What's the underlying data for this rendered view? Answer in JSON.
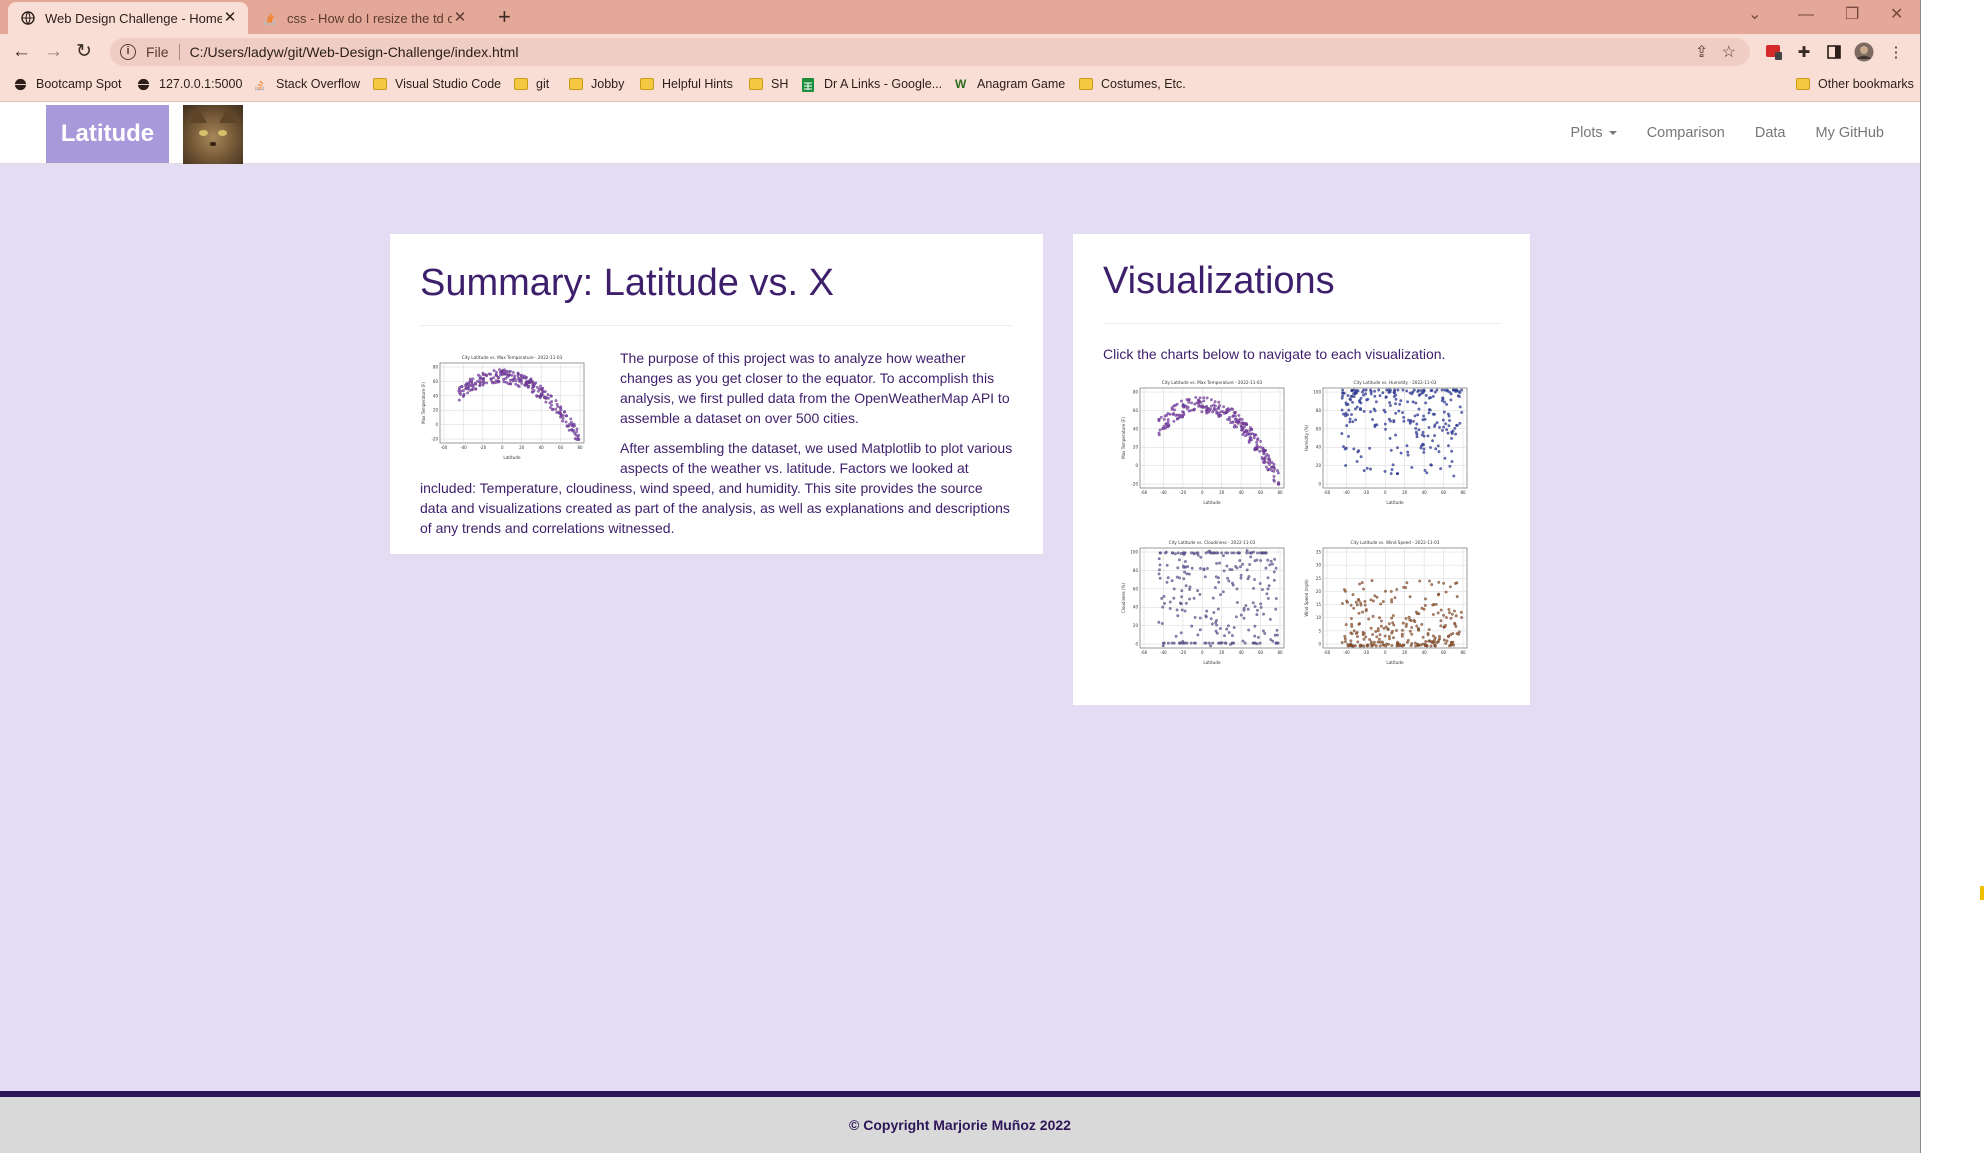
{
  "browser": {
    "tabs": [
      {
        "title": "Web Design Challenge - Home",
        "active": true,
        "icon": "globe-icon"
      },
      {
        "title": "css - How do I resize the td of a t",
        "active": false,
        "icon": "stackoverflow-icon"
      }
    ],
    "address": {
      "scheme": "File",
      "url": "C:/Users/ladyw/git/Web-Design-Challenge/index.html"
    },
    "bookmarks": [
      {
        "label": "Bootcamp Spot",
        "icon": "globe-icon"
      },
      {
        "label": "127.0.0.1:5000",
        "icon": "globe-icon"
      },
      {
        "label": "Stack Overflow",
        "icon": "stackoverflow-icon"
      },
      {
        "label": "Visual Studio Code",
        "icon": "folder-icon"
      },
      {
        "label": "git",
        "icon": "folder-icon"
      },
      {
        "label": "Jobby",
        "icon": "folder-icon"
      },
      {
        "label": "Helpful Hints",
        "icon": "folder-icon"
      },
      {
        "label": "SH",
        "icon": "folder-icon"
      },
      {
        "label": "Dr A Links - Google...",
        "icon": "sheets-icon"
      },
      {
        "label": "Anagram Game",
        "icon": "w-icon"
      },
      {
        "label": "Costumes, Etc.",
        "icon": "folder-icon"
      }
    ],
    "other_bookmarks": "Other bookmarks"
  },
  "navbar": {
    "brand": "Latitude",
    "links": {
      "plots": "Plots",
      "comparison": "Comparison",
      "data": "Data",
      "github": "My GitHub"
    }
  },
  "summary": {
    "title": "Summary: Latitude vs. X",
    "paragraph1": "The purpose of this project was to analyze how weather changes as you get closer to the equator. To accomplish this analysis, we first pulled data from the OpenWeatherMap API to assemble a dataset on over 500 cities.",
    "paragraph2": "After assembling the dataset, we used Matplotlib to plot various aspects of the weather vs. latitude. Factors we looked at included: Temperature, cloudiness, wind speed, and humidity. This site provides the source data and visualizations created as part of the analysis, as well as explanations and descriptions of any trends and correlations witnessed.",
    "thumbnail_title": "City Latitude vs. Max Temperature - 2022-11-03"
  },
  "visualizations": {
    "title": "Visualizations",
    "intro": "Click the charts below to navigate to each visualization.",
    "charts": [
      {
        "key": "temp",
        "title": "City Latitude vs. Max Temperature - 2022-11-03",
        "ylabel": "Max Temperature (F)",
        "xlabel": "Latitude",
        "color": "#8a3fc2",
        "shape": "arch",
        "yticks": [
          "-20",
          "0",
          "20",
          "40",
          "60",
          "80"
        ]
      },
      {
        "key": "humid",
        "title": "City Latitude vs. Humidity - 2022-11-03",
        "ylabel": "Humidity (%)",
        "xlabel": "Latitude",
        "color": "#2b3bb5",
        "shape": "topheavy",
        "yticks": [
          "0",
          "20",
          "40",
          "60",
          "80",
          "100"
        ]
      },
      {
        "key": "cloud",
        "title": "City Latitude vs. Cloudiness - 2022-11-03",
        "ylabel": "Cloudiness (%)",
        "xlabel": "Latitude",
        "color": "#6a5aa8",
        "shape": "spread",
        "yticks": [
          "0",
          "20",
          "40",
          "60",
          "80",
          "100"
        ]
      },
      {
        "key": "wind",
        "title": "City Latitude vs. Wind Speed - 2022-11-03",
        "ylabel": "Wind Speed (mph)",
        "xlabel": "Latitude",
        "color": "#a0552a",
        "shape": "bottom",
        "yticks": [
          "0",
          "5",
          "10",
          "15",
          "20",
          "25",
          "30",
          "35"
        ]
      }
    ],
    "xticks": [
      "-60",
      "-40",
      "-20",
      "0",
      "20",
      "40",
      "60",
      "80"
    ]
  },
  "footer": {
    "text": "© Copyright Marjorie Muñoz 2022"
  },
  "colors": {
    "accent": "#3d1f6b",
    "brand_bg": "#a899db",
    "page_bg": "#e3dcf3"
  }
}
